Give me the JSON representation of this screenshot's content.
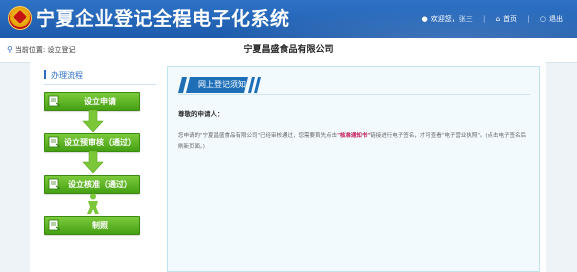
{
  "header": {
    "title": "宁夏企业登记全程电子化系统",
    "welcome": "欢迎您，",
    "username": "张三",
    "home_label": "首页",
    "logout_label": "退出"
  },
  "breadcrumb": {
    "prefix": "当前位置:",
    "current": "设立登记"
  },
  "company_name": "宁夏昌盛食品有限公司",
  "flow": {
    "title": "办理流程",
    "steps": [
      {
        "label": "设立申请"
      },
      {
        "label": "设立预审核（通过）"
      },
      {
        "label": "设立核准（通过）"
      },
      {
        "label": "制照"
      }
    ]
  },
  "notice": {
    "tab_label": "网上登记须知",
    "greeting": "尊敬的申请人：",
    "body_before": "您申请的\"宁夏昌盛食品有限公司\"已经审核通过，您需要首先点击",
    "body_link": "\"核准通知书\"",
    "body_after": "链接进行电子签名，才可查看\"电子营业执照\"。(点击电子签名后刷新页面。)"
  },
  "colors": {
    "header_blue": "#1c5aab",
    "step_green": "#45a013",
    "accent_blue": "#2a6cc2",
    "link_magenta": "#c2185b"
  }
}
